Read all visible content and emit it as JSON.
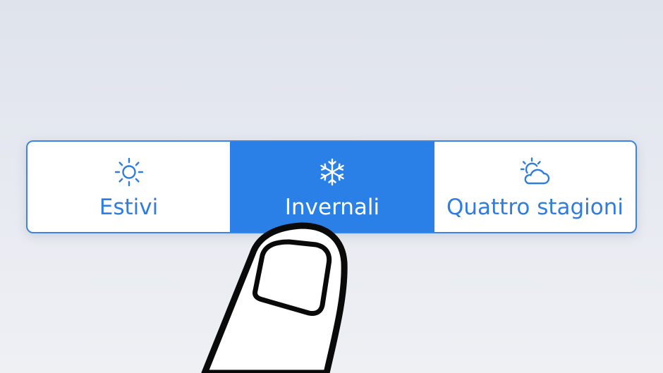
{
  "tire_selector": {
    "options": [
      {
        "label": "Estivi",
        "icon": "sun-icon",
        "selected": false
      },
      {
        "label": "Invernali",
        "icon": "snowflake-icon",
        "selected": true
      },
      {
        "label": "Quattro stagioni",
        "icon": "sun-cloud-icon",
        "selected": false
      }
    ],
    "colors": {
      "accent": "#2a80e6",
      "selected_text": "#ffffff",
      "unselected_background": "#ffffff"
    }
  }
}
